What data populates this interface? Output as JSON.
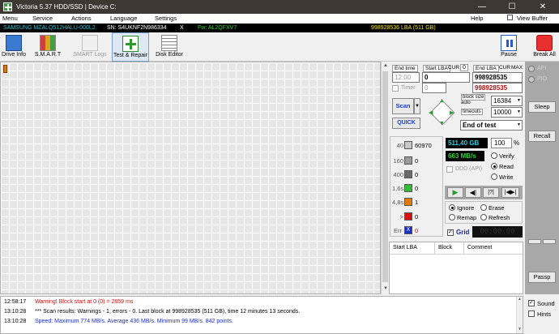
{
  "title": "Victoria 5.37 HDD/SSD | Device C:",
  "menu": {
    "items": [
      "Menu",
      "Service",
      "Actions",
      "Language",
      "Settings"
    ],
    "help": "Help",
    "viewbuffer": "View Buffer Live"
  },
  "device": {
    "model": "SAMSUNG MZALQ512HALU-000L2",
    "sn": "SN: S4UKNF2N986334",
    "x": "X",
    "fw": "Fw: AL2QFXV7",
    "lba": "998928536 LBA (511 GB)"
  },
  "toolbar": {
    "drive_info": "Drive Info",
    "smart": "S.M.A.R.T",
    "smart_logs": "SMART Logs",
    "test_repair": "Test & Repair",
    "disk_editor": "Disk Editor",
    "pause": "Pause",
    "break_all": "Break All"
  },
  "test": {
    "end_time_label": "End time",
    "end_time": "12:00",
    "timer_label": "Timer",
    "timer_value": "0",
    "start_lba_label": "Start LBA",
    "cur_label": "CUR",
    "cur_value": "0",
    "start_lba": "0",
    "end_lba_label": "End LBA",
    "end_cur_label": "CUR",
    "max_label": "MAX",
    "end_lba": "998928535",
    "end_lba_red": "998928535",
    "scan": "Scan",
    "quick": "QUICK",
    "block_size_label": "block size",
    "auto_label": "auto",
    "timeouts_label": "timeouts",
    "block_size": "16384",
    "timeout": "10000",
    "end_mode": "End of test"
  },
  "stats": {
    "counters": [
      {
        "label": "40",
        "value": "60970",
        "color": "#c8c8c8"
      },
      {
        "label": "160",
        "value": "0",
        "color": "#9a9a9a"
      },
      {
        "label": "400",
        "value": "0",
        "color": "#6a6a6a"
      },
      {
        "label": "1,6s",
        "value": "0",
        "color": "#2fbf2f"
      },
      {
        "label": "4,8s",
        "value": "1",
        "color": "#e07a00"
      },
      {
        "label": ">",
        "value": "0",
        "color": "#d81010"
      },
      {
        "label": "Err",
        "value": "0",
        "color": "#1a2cc8",
        "mark": "X"
      }
    ],
    "size": "511,40 GB",
    "percent": "100",
    "percent_sign": "%",
    "speed": "663 MB/s",
    "ddd": "DDD (API)",
    "verify": "Verify",
    "read": "Read",
    "write": "Write",
    "ignore": "Ignore",
    "erase": "Erase",
    "remap": "Remap",
    "refresh": "Refresh",
    "grid": "Grid",
    "timer_display": "00:00:00"
  },
  "table": {
    "columns": [
      "Start LBA",
      "Block",
      "Comment"
    ]
  },
  "side": {
    "api": "API",
    "pio": "PIO",
    "sleep": "Sleep",
    "recall": "Recall",
    "passp": "Passp"
  },
  "log": [
    {
      "time": "12:58:17",
      "text": "Warning! Block start at 0 (0)  = 2859 ms",
      "color": "#c81414"
    },
    {
      "time": "13:10:28",
      "text": "*** Scan results: Warnings - 1, errors - 0. Last block at 998928535 (511 GB), time 12 minutes 13 seconds.",
      "color": "#000000"
    },
    {
      "time": "13:10:28",
      "text": "Speed: Maximum 774 MB/s. Average 436 MB/s. Minimum 99 MB/s. 842 points.",
      "color": "#1a2ccf"
    }
  ],
  "bottom": {
    "sound": "Sound",
    "hints": "Hints"
  }
}
